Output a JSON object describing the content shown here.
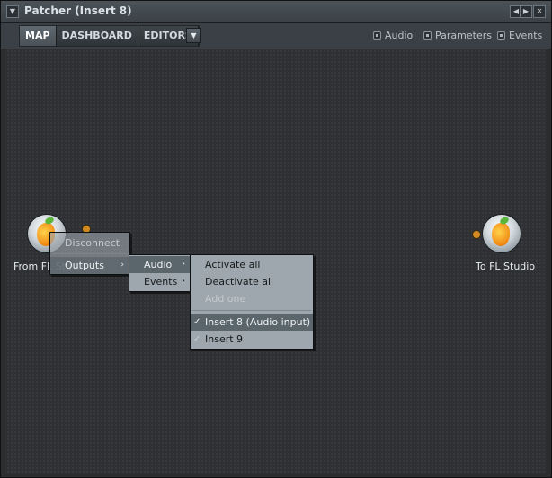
{
  "window": {
    "title": "Patcher (Insert 8)"
  },
  "toolbar": {
    "tabs": [
      {
        "label": "MAP",
        "active": true
      },
      {
        "label": "DASHBOARD",
        "active": false
      },
      {
        "label": "EDITORS",
        "active": false
      }
    ],
    "filters": [
      "Audio",
      "Parameters",
      "Events"
    ]
  },
  "nodes": {
    "from": {
      "label": "From FL Studio"
    },
    "to": {
      "label": "To FL Studio"
    }
  },
  "context_menu": {
    "level1": [
      "Disconnect",
      "Outputs"
    ],
    "level2": [
      "Audio",
      "Events"
    ],
    "level3": [
      {
        "label": "Activate all",
        "checked": false,
        "disabled": false
      },
      {
        "label": "Deactivate all",
        "checked": false,
        "disabled": false
      },
      {
        "label": "Add one",
        "checked": false,
        "disabled": true
      },
      {
        "label": "Insert 8 (Audio input)",
        "checked": true,
        "disabled": false
      },
      {
        "label": "Insert 9",
        "checked": false,
        "disabled": false
      }
    ]
  },
  "colors": {
    "port": "#d08a1f",
    "menu_bg": "#9ea7ad",
    "menu_highlight": "#5b656c"
  }
}
